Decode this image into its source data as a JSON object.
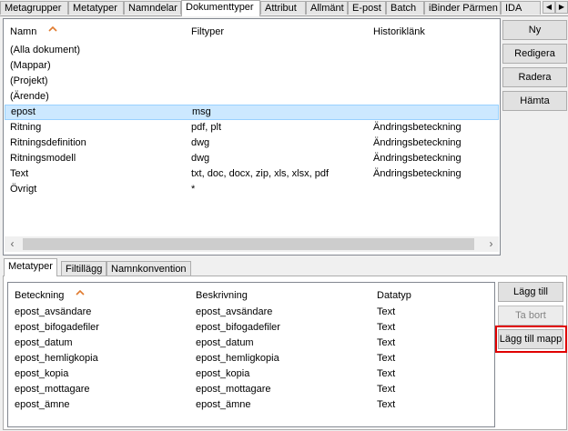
{
  "top_tabs": [
    "Metagrupper",
    "Metatyper",
    "Namndelar",
    "Dokumenttyper",
    "Attribut",
    "Allmänt",
    "E-post",
    "Batch",
    "iBinder Pärmen",
    "IDA"
  ],
  "active_top_tab": "Dokumenttyper",
  "doc_types": {
    "columns": [
      "Namn",
      "Filtyper",
      "Historiklänk"
    ],
    "rows": [
      {
        "name": "(Alla dokument)",
        "filetypes": "",
        "history": ""
      },
      {
        "name": "(Mappar)",
        "filetypes": "",
        "history": ""
      },
      {
        "name": "(Projekt)",
        "filetypes": "",
        "history": ""
      },
      {
        "name": "(Ärende)",
        "filetypes": "",
        "history": ""
      },
      {
        "name": "epost",
        "filetypes": "msg",
        "history": ""
      },
      {
        "name": "Ritning",
        "filetypes": "pdf, plt",
        "history": "Ändringsbeteckning"
      },
      {
        "name": "Ritningsdefinition",
        "filetypes": "dwg",
        "history": "Ändringsbeteckning"
      },
      {
        "name": "Ritningsmodell",
        "filetypes": "dwg",
        "history": "Ändringsbeteckning"
      },
      {
        "name": "Text",
        "filetypes": "txt, doc, docx, zip, xls, xlsx, pdf",
        "history": "Ändringsbeteckning"
      },
      {
        "name": "Övrigt",
        "filetypes": "*",
        "history": ""
      }
    ],
    "selected_index": 4,
    "buttons": [
      "Ny",
      "Redigera",
      "Radera",
      "Hämta"
    ]
  },
  "sub_tabs": [
    "Metatyper",
    "Filtillägg",
    "Namnkonvention"
  ],
  "active_sub_tab": "Metatyper",
  "metatypes": {
    "columns": [
      "Beteckning",
      "Beskrivning",
      "Datatyp"
    ],
    "rows": [
      {
        "code": "epost_avsändare",
        "desc": "epost_avsändare",
        "type": "Text"
      },
      {
        "code": "epost_bifogadefiler",
        "desc": "epost_bifogadefiler",
        "type": "Text"
      },
      {
        "code": "epost_datum",
        "desc": "epost_datum",
        "type": "Text"
      },
      {
        "code": "epost_hemligkopia",
        "desc": "epost_hemligkopia",
        "type": "Text"
      },
      {
        "code": "epost_kopia",
        "desc": "epost_kopia",
        "type": "Text"
      },
      {
        "code": "epost_mottagare",
        "desc": "epost_mottagare",
        "type": "Text"
      },
      {
        "code": "epost_ämne",
        "desc": "epost_ämne",
        "type": "Text"
      }
    ],
    "buttons": {
      "add": "Lägg till",
      "remove": "Ta bort",
      "add_to_folder": "Lägg till mapp"
    }
  },
  "colors": {
    "selected_row": "#cce8ff",
    "highlight_border": "#e00000"
  }
}
